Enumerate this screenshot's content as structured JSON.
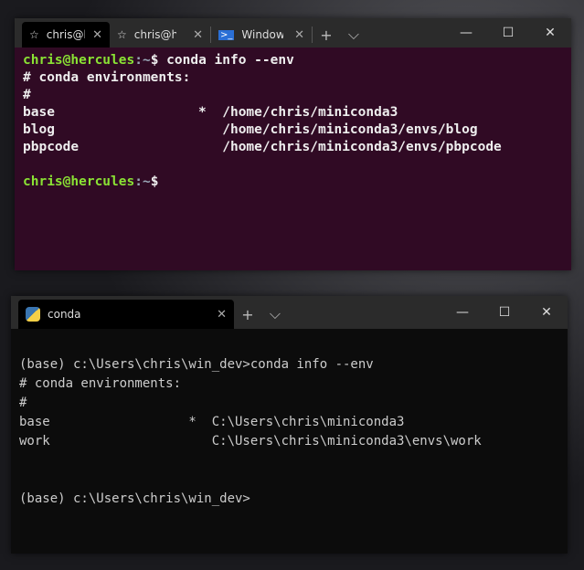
{
  "wsl_window": {
    "tabs": [
      {
        "label": "chris@hercules",
        "icon": "linux-icon",
        "active": true
      },
      {
        "label": "chris@hercules",
        "icon": "linux-icon",
        "active": false
      },
      {
        "label": "Windows PowerShell",
        "icon": "powershell-icon",
        "active": false
      }
    ],
    "tab_labels_visible": [
      "chris@hе",
      "chris@hе",
      "Window"
    ],
    "prompt_user": "chris@hercules",
    "prompt_path": ":~",
    "prompt_sym": "$",
    "command": " conda info --env",
    "output": [
      "# conda environments:",
      "#",
      "base                  *  /home/chris/miniconda3",
      "blog                     /home/chris/miniconda3/envs/blog",
      "pbpcode                  /home/chris/miniconda3/envs/pbpcode",
      ""
    ],
    "background": "#300a24"
  },
  "conda_window": {
    "tabs": [
      {
        "label": "conda",
        "icon": "python-icon",
        "active": true
      }
    ],
    "lines": [
      "(base) c:\\Users\\chris\\win_dev>conda info --env",
      "# conda environments:",
      "#",
      "base                  *  C:\\Users\\chris\\miniconda3",
      "work                     C:\\Users\\chris\\miniconda3\\envs\\work",
      "",
      "",
      "(base) c:\\Users\\chris\\win_dev>"
    ],
    "background": "#0c0c0c"
  },
  "icons": {
    "close": "✕",
    "new_tab": "+",
    "dropdown": "⌵",
    "minimize": "—",
    "maximize": "☐"
  }
}
